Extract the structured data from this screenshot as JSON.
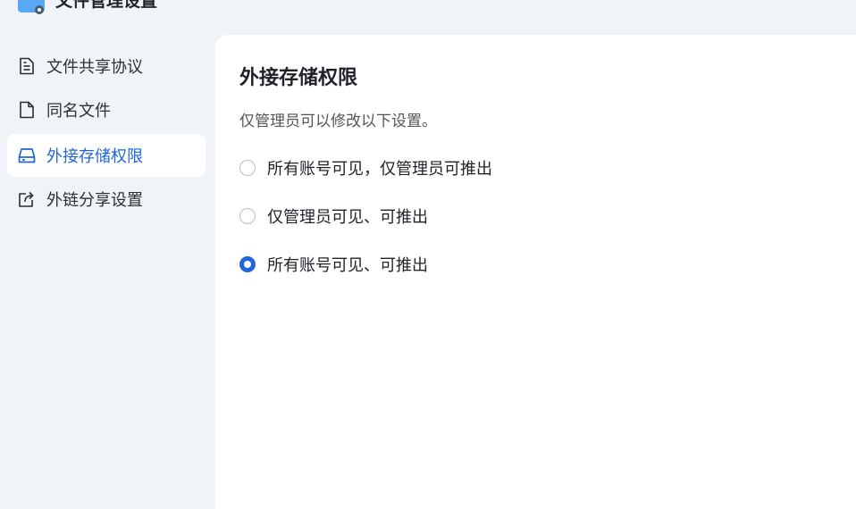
{
  "app": {
    "title": "文件管理设置",
    "icon": "folder-settings-icon"
  },
  "sidebar": {
    "items": [
      {
        "label": "文件共享协议",
        "icon": "document-icon",
        "active": false
      },
      {
        "label": "同名文件",
        "icon": "file-icon",
        "active": false
      },
      {
        "label": "外接存储权限",
        "icon": "external-drive-icon",
        "active": true
      },
      {
        "label": "外链分享设置",
        "icon": "share-icon",
        "active": false
      }
    ]
  },
  "main": {
    "title": "外接存储权限",
    "description": "仅管理员可以修改以下设置。",
    "options": [
      {
        "label": "所有账号可见，仅管理员可推出",
        "checked": false
      },
      {
        "label": "仅管理员可见、可推出",
        "checked": false
      },
      {
        "label": "所有账号可见、可推出",
        "checked": true
      }
    ]
  },
  "colors": {
    "accent": "#2166d8",
    "sidebar_bg": "#f0f3f8",
    "panel_bg": "#ffffff",
    "text": "#1f2329"
  }
}
